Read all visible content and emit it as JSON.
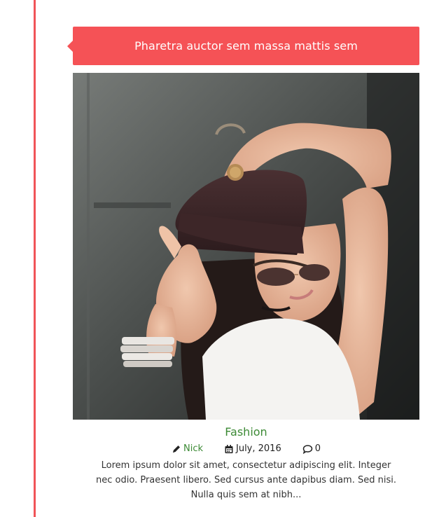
{
  "post": {
    "title": "Pharetra auctor sem massa mattis sem",
    "category": "Fashion",
    "author": "Nick",
    "date": "July, 2016",
    "comments": "0",
    "excerpt": "Lorem ipsum dolor sit amet, consectetur adipiscing elit. Integer nec odio. Praesent libero. Sed cursus ante dapibus diam. Sed nisi. Nulla quis sem at nibh..."
  },
  "icons": {
    "author": "pencil-icon",
    "date": "calendar-icon",
    "comments": "comment-icon"
  },
  "colors": {
    "accent": "#f55256",
    "timeline": "#f05458",
    "link": "#3c8a35",
    "text": "#333333"
  }
}
